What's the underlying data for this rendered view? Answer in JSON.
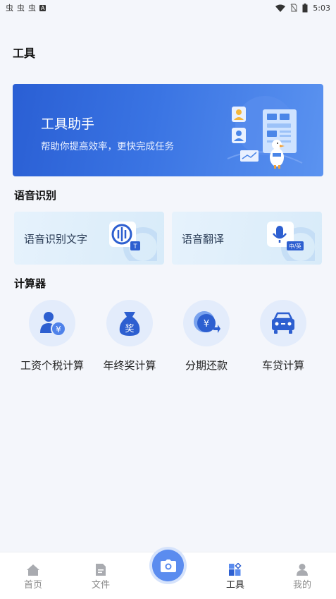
{
  "status_bar": {
    "left_icons": [
      "虫",
      "虫",
      "虫"
    ],
    "notification_badge": "A",
    "time": "5:03",
    "icons": [
      "wifi-icon",
      "no-sim-icon",
      "battery-icon"
    ]
  },
  "page": {
    "title": "工具"
  },
  "banner": {
    "title": "工具助手",
    "subtitle": "帮助你提高效率，更快完成任务",
    "colors": {
      "start": "#2a5fd4",
      "end": "#5b93f0"
    }
  },
  "voice_section": {
    "title": "语音识别",
    "cards": [
      {
        "label": "语音识别文字",
        "icon": "speech-to-text-icon",
        "badge": "T"
      },
      {
        "label": "语音翻译",
        "icon": "microphone-icon",
        "badge": "中/英"
      }
    ]
  },
  "calculator_section": {
    "title": "计算器",
    "items": [
      {
        "label": "工资个税计算",
        "icon": "salary-tax-icon"
      },
      {
        "label": "年终奖计算",
        "icon": "bonus-bag-icon",
        "glyph": "奖"
      },
      {
        "label": "分期还款",
        "icon": "installment-coins-icon"
      },
      {
        "label": "车贷计算",
        "icon": "car-loan-icon"
      }
    ]
  },
  "tabbar": {
    "tabs": [
      {
        "label": "首页",
        "icon": "home-icon",
        "active": false
      },
      {
        "label": "文件",
        "icon": "file-icon",
        "active": false
      },
      {
        "label": "工具",
        "icon": "tools-icon",
        "active": true
      },
      {
        "label": "我的",
        "icon": "profile-icon",
        "active": false
      }
    ],
    "center_button": {
      "icon": "camera-icon"
    },
    "colors": {
      "accent": "#5b8cef",
      "inactive": "#8c8c8c"
    }
  }
}
